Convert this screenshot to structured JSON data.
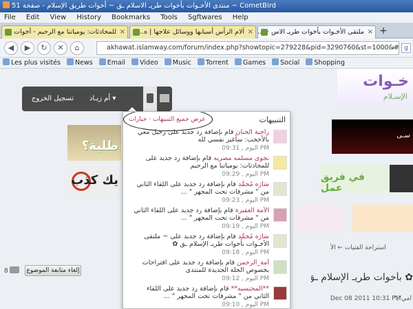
{
  "window": {
    "title": "منتدى الأخـوات بأخوات طريـ الاسلام ـق ~ أخوات طريق الإسلام - صفحة 51 ~ CometBird"
  },
  "menu": [
    "File",
    "Edit",
    "View",
    "History",
    "Bookmarks",
    "Tools",
    "Sgftwares",
    "Help"
  ],
  "tabs": [
    {
      "label": "للمحادثات: يومياتنا مع الرحيم - أخوات ...",
      "active": false
    },
    {
      "label": "آلام الرأس أسبابها ووسائل علاجها | ه...",
      "active": false
    },
    {
      "label": "ملتقى الأخـوات بأخوات طريـ الاس ~ ...",
      "active": true
    }
  ],
  "nav": {
    "url": "akhawat.islamway.com/forum/index.php?showtopic=279228&pid=3290760&st=1000&#entry3290760"
  },
  "bookmarks": [
    "Les plus visités",
    "News",
    "Email",
    "Video",
    "Music",
    "Torrent",
    "Games",
    "Social",
    "Shopping"
  ],
  "page": {
    "logo_line1": "خـوات",
    "logo_line2": "الإسـلام",
    "userbar": {
      "logout": "تسجيل الخروج",
      "username": "أم زيـاد ▾"
    },
    "banner_left1": "طلبة؟",
    "banner_left2": "يك كذب",
    "banner_right1": "سـى",
    "banner_right2": "في فريق عمل",
    "breadcrumb": "استراحة الفتيات ← الأ",
    "topic_title": "✿ بأخوات طريـ الإسلام ـق ~",
    "post_date": "Dec 08 2011 10:31 PM",
    "poster": "امي\",\"",
    "follow_count": "8",
    "follow_button": "إلغاء متابعة الموضوع"
  },
  "notifications": {
    "title": "التنبيهات",
    "view_all": "عرض جميع التنبيهات · خيارات",
    "items": [
      {
        "sender": "راجية الجنان",
        "text": "قام بإضافة رد جديد على رحيل معي بالأحجب: سأغير نفسي لله",
        "time": "اليوم , 09:31 PM"
      },
      {
        "sender": "نجوى مسلمه مصريه",
        "text": "قام بإضافة رد جديد على للمحادثات: يومياتنا مع الرحيم",
        "time": "اليوم , 09:29 PM"
      },
      {
        "sender": "سَارَه مُحمَّد",
        "text": "قام بإضافة رد جديد على اللقاء الثاني من \" مشرقات تحت المجهر \" ...",
        "time": "اليوم , 09:23 PM"
      },
      {
        "sender": "الأمة الغفيرة",
        "text": "قام بإضافة رد جديد على اللقاء الثاني من \" مشرقات تحت المجهر \" ...",
        "time": "اليوم , 09:19 PM"
      },
      {
        "sender": "سَارَه مُحمَّد",
        "text": "قام بإضافة رد جديد على ~ ملتقى الأخـوات بأخوات طريـ الإسلام ـق ✿",
        "time": "اليوم , 09:18 PM"
      },
      {
        "sender": "أمة_الرحمن",
        "text": "قام بإضافة رد جديد على اقتراحات بخصوص الحلة الجديدة للمنتدى",
        "time": "اليوم , 09:12 PM"
      },
      {
        "sender": "**المحتسبه**",
        "text": "قام بإضافة رد جديد على اللقاء الثاني من \" مشرقات تحت المجهر \" ...",
        "time": "اليوم , 09:10 PM"
      }
    ]
  }
}
